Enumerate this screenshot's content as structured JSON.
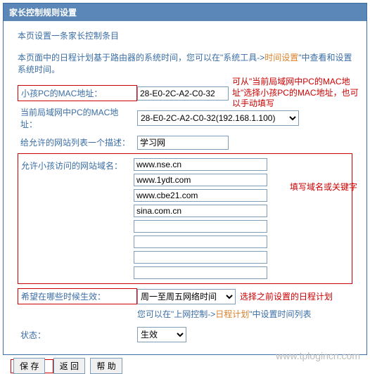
{
  "panel": {
    "title": "家长控制规则设置"
  },
  "intro": {
    "line1": "本页设置一条家长控制条目",
    "line2_before": "本页面中的日程计划基于路由器的系统时间，您可以在\"系统工具->",
    "line2_link": "时间设置",
    "line2_after": "\"中查看和设置系统时间。"
  },
  "annotations": {
    "mac_hint": "可从\"当前局域网中PC的MAC地址\"选择小孩PC的MAC地址，也可以手动填写",
    "domain_hint": "填写域名或关键字",
    "schedule_hint": "选择之前设置的日程计划"
  },
  "fields": {
    "child_mac": {
      "label": "小孩PC的MAC地址：",
      "value": "28-E0-2C-A2-C0-32"
    },
    "lan_mac": {
      "label": "当前局域网中PC的MAC地址：",
      "value": "28-E0-2C-A2-C0-32(192.168.1.100)"
    },
    "description": {
      "label": "给允许的网站列表一个描述：",
      "value": "学习网"
    },
    "allowed_domains": {
      "label": "允许小孩访问的网站域名：",
      "values": [
        "www.nse.cn",
        "www.1ydt.com",
        "www.cbe21.com",
        "sina.com.cn",
        "",
        "",
        "",
        ""
      ]
    },
    "schedule": {
      "label": "希望在哪些时候生效：",
      "value": "周一至周五网络时间"
    },
    "schedule_note_before": "您可以在\"上网控制->",
    "schedule_note_link": "日程计划",
    "schedule_note_after": "\"中设置时间列表",
    "status": {
      "label": "状态：",
      "value": "生效"
    }
  },
  "buttons": {
    "save": "保 存",
    "back": "返 回",
    "help": "帮 助"
  },
  "watermark": "www.tplogincn.com"
}
